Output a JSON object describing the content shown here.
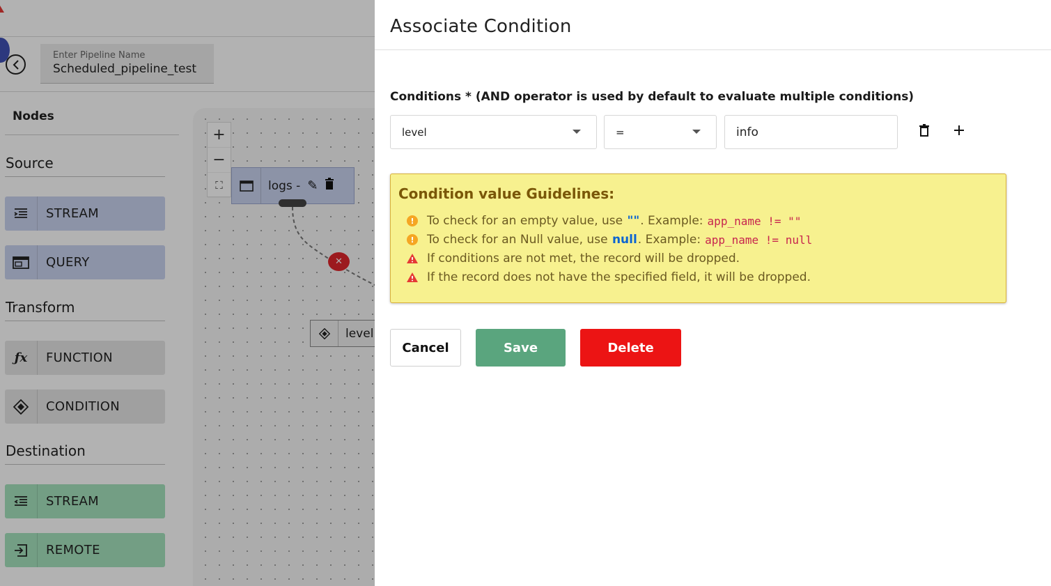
{
  "pipeline": {
    "name_label": "Enter Pipeline Name",
    "name_value": "Scheduled_pipeline_test"
  },
  "sidebar": {
    "title": "Nodes",
    "sections": {
      "source": "Source",
      "transform": "Transform",
      "destination": "Destination"
    },
    "source_items": [
      {
        "label": "STREAM",
        "icon": "stream-icon"
      },
      {
        "label": "QUERY",
        "icon": "query-icon"
      }
    ],
    "transform_items": [
      {
        "label": "FUNCTION",
        "icon": "function-icon"
      },
      {
        "label": "CONDITION",
        "icon": "condition-icon"
      }
    ],
    "destination_items": [
      {
        "label": "STREAM",
        "icon": "stream-out-icon"
      },
      {
        "label": "REMOTE",
        "icon": "remote-icon"
      }
    ]
  },
  "canvas": {
    "source_node_label": "logs -",
    "condition_node_label": "level"
  },
  "dialog": {
    "title": "Associate Condition",
    "conditions_label": "Conditions * (AND operator is used by default to evaluate multiple conditions)",
    "condition": {
      "field": "level",
      "operator": "=",
      "value": "info"
    },
    "guidelines": {
      "title": "Condition value Guidelines:",
      "empty_value": {
        "prefix": "To check for an empty value, use ",
        "keyword": "\"\"",
        "suffix": ". Example:",
        "example": "app_name != \"\""
      },
      "null_value": {
        "prefix": "To check for an Null value, use ",
        "keyword": "null",
        "suffix": ". Example:",
        "example": "app_name != null"
      },
      "warnings": [
        "If conditions are not met, the record will be dropped.",
        "If the record does not have the specified field, it will be dropped."
      ]
    },
    "buttons": {
      "cancel": "Cancel",
      "save": "Save",
      "delete": "Delete"
    }
  },
  "colors": {
    "save": "#5aa57e",
    "delete": "#ec1414",
    "guide_bg": "#f7f18f",
    "source_node": "#c9d3f0",
    "destination_node": "#a5e3bd"
  }
}
